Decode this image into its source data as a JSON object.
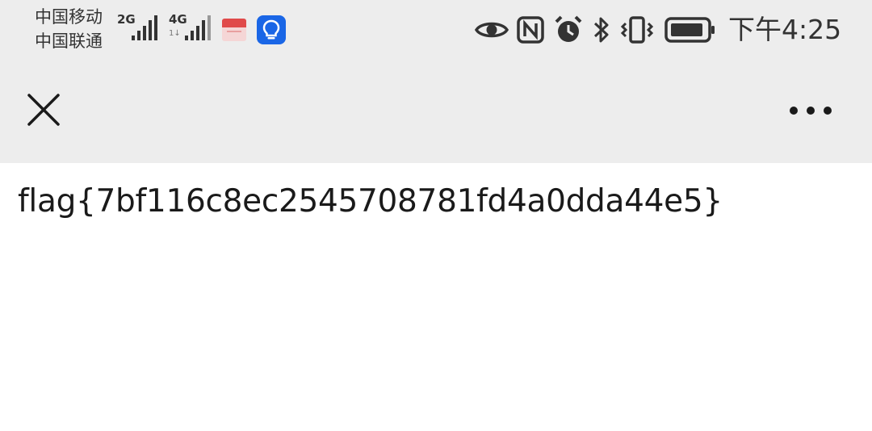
{
  "status_bar": {
    "carrier_1": "中国移动",
    "carrier_2": "中国联通",
    "network_1": "2G",
    "network_2": "4G",
    "network_2_sub": "1↓",
    "time": "下午4:25",
    "icons": [
      "signal-icon",
      "red-app-icon",
      "bulb-app-icon",
      "eye-icon",
      "nfc-icon",
      "alarm-icon",
      "bluetooth-icon",
      "vibrate-icon",
      "battery-icon"
    ]
  },
  "nav_bar": {
    "close_icon": "close-icon",
    "more_icon": "more-icon"
  },
  "content": {
    "text": "flag{7bf116c8ec2545708781fd4a0dda44e5}"
  }
}
